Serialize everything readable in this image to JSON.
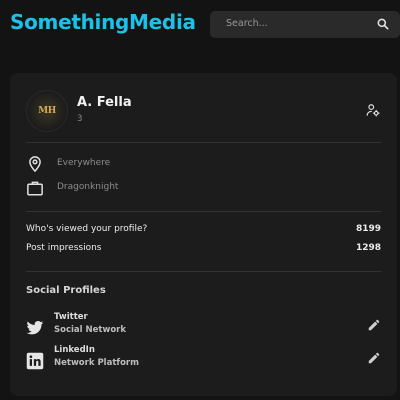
{
  "app": {
    "brand": "SomethingMedia",
    "brand_color": "#1ec0ea"
  },
  "search": {
    "placeholder": "Search...",
    "icon": "search-icon"
  },
  "profile": {
    "avatar_text": "MH",
    "name": "A. Fella",
    "subtitle": "3",
    "settings_icon": "user-settings-icon",
    "info": [
      {
        "icon": "location-pin-icon",
        "label": "Everywhere"
      },
      {
        "icon": "briefcase-icon",
        "label": "Dragonknight"
      }
    ],
    "stats": [
      {
        "label": "Who's viewed your profile?",
        "value": "8199"
      },
      {
        "label": "Post impressions",
        "value": "1298"
      }
    ]
  },
  "social": {
    "title": "Social Profiles",
    "items": [
      {
        "icon": "twitter-icon",
        "name": "Twitter",
        "subtitle": "Social Network",
        "edit_icon": "pencil-icon"
      },
      {
        "icon": "linkedin-icon",
        "name": "LinkedIn",
        "subtitle": "Network Platform",
        "edit_icon": "pencil-icon"
      }
    ]
  }
}
